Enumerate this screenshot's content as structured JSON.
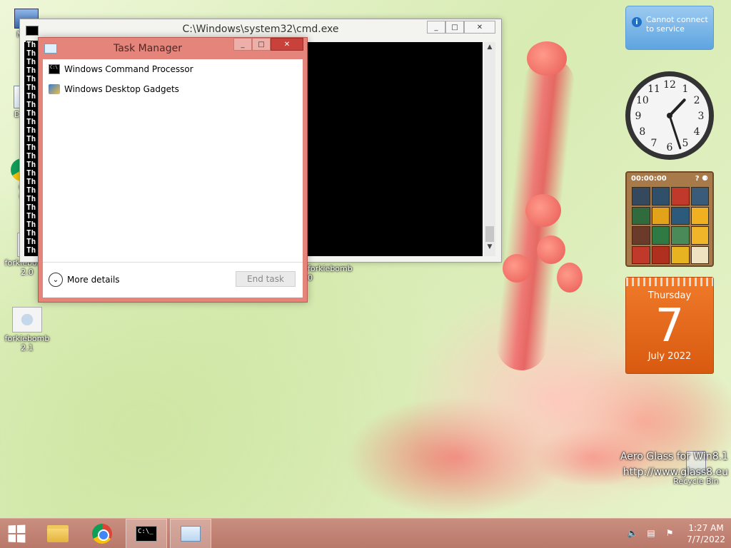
{
  "desktop": {
    "icons": [
      {
        "label": "My C",
        "name": "desktop-icon-my-computer"
      },
      {
        "label": "Data",
        "name": "desktop-icon-data"
      },
      {
        "label": "G\nC",
        "name": "desktop-icon-google-chrome"
      },
      {
        "label": "forkiebomb\n2.0",
        "name": "desktop-icon-forkiebomb-2-0"
      },
      {
        "label": "forkiebomb\n2.1",
        "name": "desktop-icon-forkiebomb-2-1"
      },
      {
        "label": "forkiebomb\n0",
        "name": "desktop-icon-forkiebomb-partial"
      },
      {
        "label": "Recycle Bin",
        "name": "desktop-icon-recycle-bin"
      }
    ],
    "watermark": {
      "line1": "Aero Glass for Win8.1",
      "line2": "http://www.glass8.eu"
    }
  },
  "cmd_window": {
    "title": "C:\\Windows\\system32\\cmd.exe",
    "visible_line_prefix": "Th",
    "line_count": 25,
    "controls": {
      "minimize": "_",
      "maximize": "□",
      "close": "✕"
    }
  },
  "task_manager": {
    "title": "Task Manager",
    "apps": [
      {
        "label": "Windows Command Processor",
        "icon": "cmd-icon"
      },
      {
        "label": "Windows Desktop Gadgets",
        "icon": "gadgets-icon"
      }
    ],
    "more_details": "More details",
    "end_task": "End task",
    "controls": {
      "minimize": "_",
      "maximize": "□",
      "close": "✕"
    }
  },
  "gadgets": {
    "notification": {
      "text_line1": "Cannot connect",
      "text_line2": "to service"
    },
    "clock": {
      "hour": 1,
      "minute": 27
    },
    "puzzle": {
      "timer": "00:00:00"
    },
    "calendar": {
      "weekday": "Thursday",
      "day": "7",
      "month_year": "July 2022"
    }
  },
  "taskbar": {
    "time": "1:27 AM",
    "date": "7/7/2022",
    "pinned": [
      "start-button",
      "file-explorer",
      "google-chrome",
      "command-prompt",
      "task-manager"
    ]
  },
  "colors": {
    "taskbar": "#b9786a",
    "task_manager_frame": "#e5847a",
    "close_button": "#c8423b",
    "calendar": "#e0661a",
    "notification": "#5ea4e0"
  }
}
